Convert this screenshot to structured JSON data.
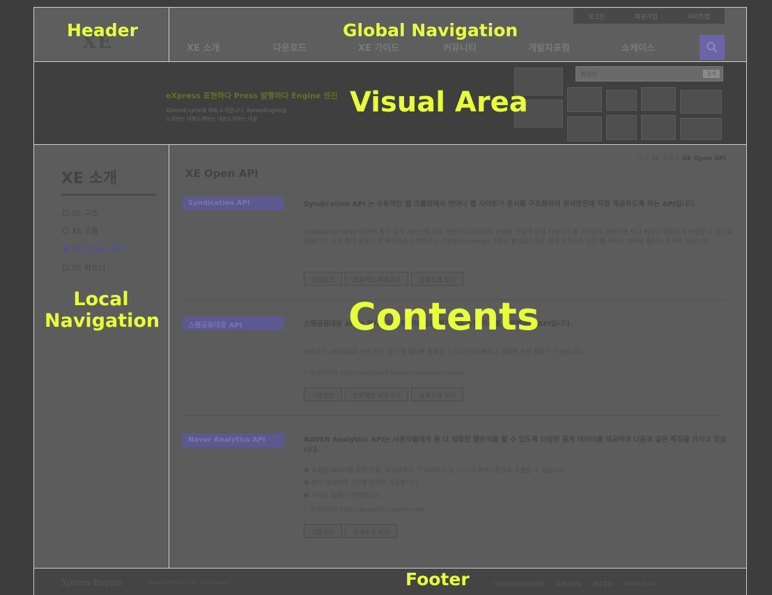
{
  "header": {
    "logo": "XE",
    "util_links": [
      "로그인",
      "회원가입",
      "사이트맵"
    ],
    "gnb": [
      "XE 소개",
      "다운로드",
      "XE 가이드",
      "커뮤니티",
      "개발자포럼",
      "쇼케이스"
    ],
    "search_icon": "search-icon"
  },
  "visual": {
    "tagline": "eXpress 표현하다   Press 발행하다   Engine 엔진",
    "desc_line1": "XpressEngine에 대해 소개합니다. XpressEngine을",
    "desc_line2": "소개하는 내용소개하는 내용소개하는 내용",
    "search_placeholder": "키워드",
    "search_button": "검색"
  },
  "lnb": {
    "title": "XE 소개",
    "items": [
      {
        "label": "XE 구조",
        "active": false
      },
      {
        "label": "XE 모듈",
        "active": false
      },
      {
        "label": "XE Open API",
        "active": true
      },
      {
        "label": "XE 파트너",
        "active": false
      }
    ]
  },
  "contents": {
    "breadcrumb_prefix": "⌂ > XE 소개 > ",
    "breadcrumb_current": "XE Open API",
    "title": "XE Open API",
    "sections": [
      {
        "label": "Syndication API",
        "headline": "Syndication API 는 수동적인 웹 크롤링에서 벗어나 웹 사이트가 문서를 구조화하여 검색엔진에 직접 제공하도록 하는 API입니다.",
        "body": "Syndication API는 네이버 등의 검색 서비스에 직접 콘텐츠의 업데이트 정보를 전달해 검색 서비스가 웹 사이트의 콘텐츠를 보다 빠르고 정확하게 반영할 수 있도록 해줍니다. 또한 검색 로봇이 웹 페이지를 수집해가는 크롤링(crawling) 과정이 필요없으므로 검색 로봇으로 인한 웹 사이트 부하를 줄이는 효과가 있습니다.",
        "buttons": [
          "다운로드",
          "프로젝트 바로가기",
          "상세소개 보기"
        ]
      },
      {
        "label": "스팸공동대응 API",
        "headline": "스팸공동대응 API는 게시물의 스팸 가능성을 평가하여 스팸 지수를 제공해주는 API입니다.",
        "body": "사용자가 사이트별로 스팸 사전 및 스팸 필터를 등록할 수 있어 보다 빠르고 정확한 스팸 분류가 가능합니다.",
        "site": "• 공식사이트   http://antispam.naver.com/openCenter/",
        "buttons": [
          "다운로드",
          "프로젝트 바로가기",
          "상세소개 보기"
        ]
      },
      {
        "label": "Naver Analytics API",
        "headline": "NAVER Analytics API는 사용자들에게 좀 더 정확한 웹분석을 할 수 있도록 다양한 통계 데이터를 제공하여 다음과 같은 특징을 가지고 있습니다.",
        "features": [
          "❶ 수집된 데이터를 방문 현황, 유입검색어, 인기페이지 등 15가지 분석기준으로 추출할 수 있습니다.",
          "❷ 분석 데이터의 기간별 검색이 가능합니다.",
          "❸ 사이트 등록이 간편합니다."
        ],
        "site": "• 공식사이트   http://analytics.naver.com/",
        "buttons": [
          "다운로드",
          "상세소개 보기"
        ]
      }
    ]
  },
  "footer": {
    "logo": "Xpress Engine",
    "copyright": "Copyright NHN Corp. All rights reserved.",
    "links": [
      "개인정보보호취급방침",
      "도메인위탁",
      "제휴문의",
      "Contact us"
    ]
  },
  "labels": {
    "header": "Header",
    "gnb": "Global Navigation",
    "visual": "Visual Area",
    "lnb_line1": "Local",
    "lnb_line2": "Navigation",
    "contents": "Contents",
    "footer": "Footer"
  },
  "colors": {
    "label": "#e7ff3a",
    "accent": "#6b65a8",
    "divider": "#d0d0d0"
  }
}
